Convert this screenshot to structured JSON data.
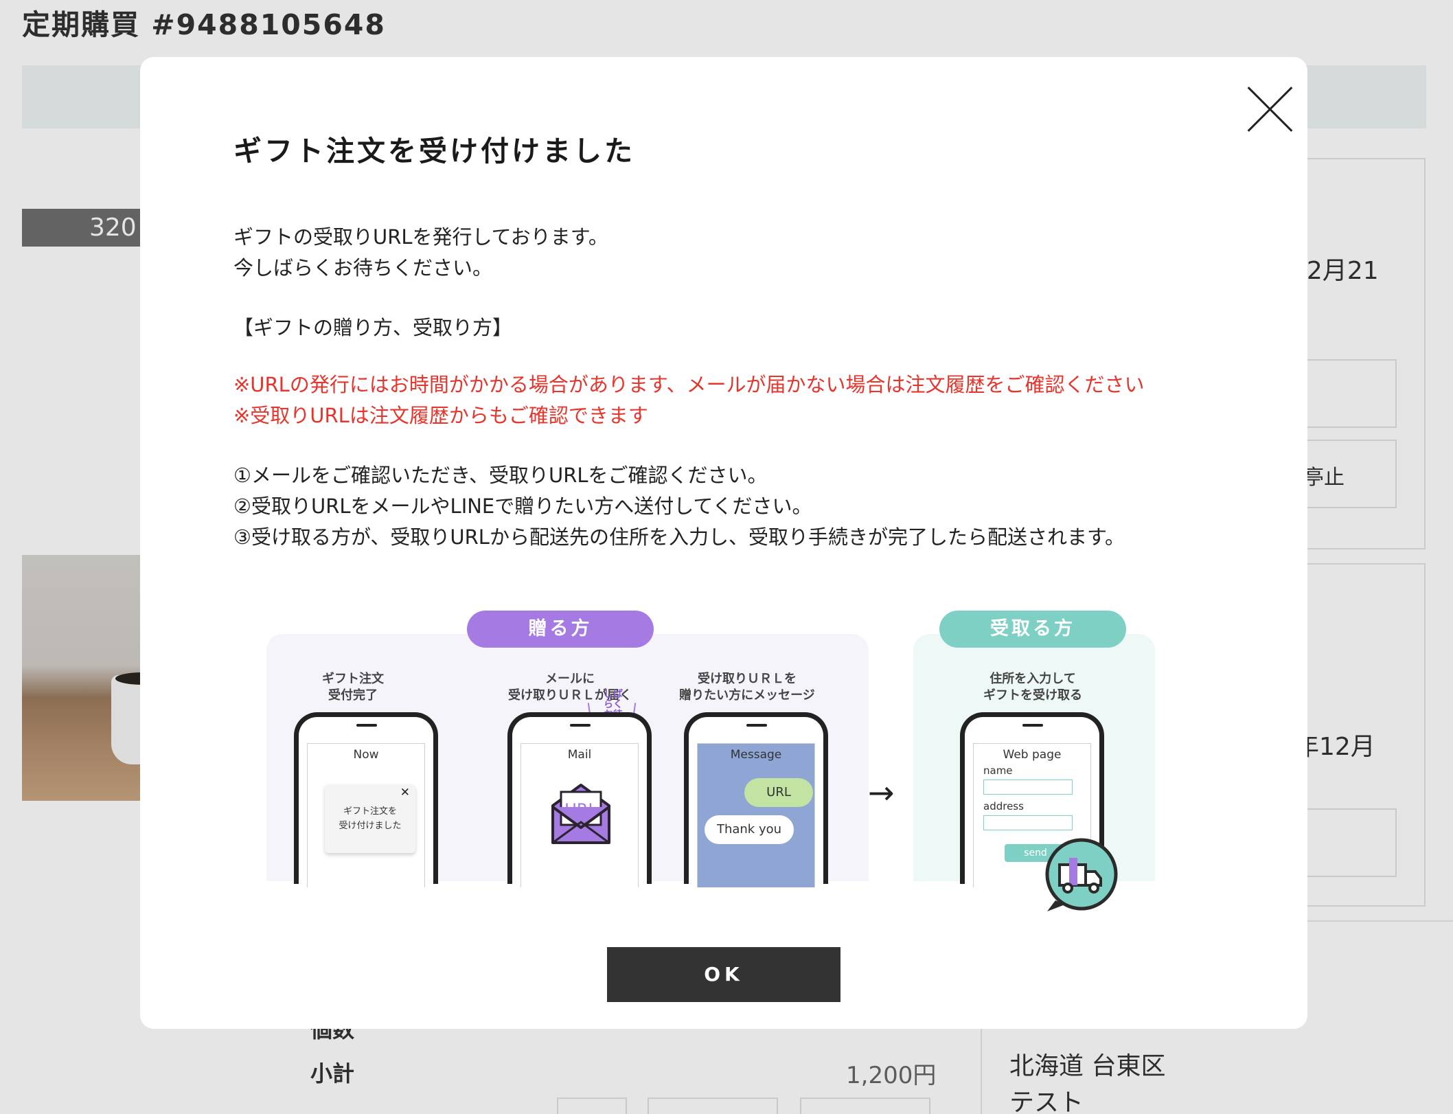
{
  "background": {
    "page_title": "定期購買 #9488105648",
    "badge_price": "320",
    "date_partial_1": "12月21",
    "stop_label_partial": "亭止",
    "date_partial_2": "年12月",
    "qty_label": "個数",
    "subtotal_label": "小計",
    "subtotal_value": "1,200円",
    "address_line1": "北海道 台東区",
    "address_line2": "テスト"
  },
  "modal": {
    "title": "ギフト注文を受け付けました",
    "intro_line1": "ギフトの受取りURLを発行しております。",
    "intro_line2": "今しばらくお待ちください。",
    "section_heading": "【ギフトの贈り方、受取り方】",
    "notice_line1": "※URLの発行にはお時間がかかる場合があります、メールが届かない場合は注文履歴をご確認ください",
    "notice_line2": "※受取りURLは注文履歴からもご確認できます",
    "step1": "①メールをご確認いただき、受取りURLをご確認ください。",
    "step2": "②受取りURLをメールやLINEで贈りたい方へ送付してください。",
    "step3": "③受け取る方が、受取りURLから配送先の住所を入力し、受取り手続きが完了したら配送されます。",
    "ok_label": "OK"
  },
  "illustration": {
    "sender_pill": "贈る方",
    "receiver_pill": "受取る方",
    "cap1": [
      "ギフト注文",
      "受付完了"
    ],
    "cap2": [
      "メールに",
      "受け取りＵＲＬが届く"
    ],
    "cap3": [
      "受け取りＵＲＬを",
      "贈りたい方にメッセージ"
    ],
    "cap4": [
      "住所を入力して",
      "ギフトを受け取る"
    ],
    "wait_text": "しばらくお待ちください",
    "screen1_label": "Now",
    "notif_line1": "ギフト注文を",
    "notif_line2": "受け付けました",
    "screen2_label": "Mail",
    "envelope_text": "URL",
    "screen3_label": "Message",
    "bubble_url": "URL",
    "bubble_thanks": "Thank you",
    "screen4_label": "Web page",
    "field_name": "name",
    "field_address": "address",
    "send_label": "send",
    "arrow": "→"
  },
  "colors": {
    "sender_accent": "#a57be3",
    "receiver_accent": "#7fd0c4",
    "notice_red": "#e5352c",
    "ok_button": "#333333"
  }
}
